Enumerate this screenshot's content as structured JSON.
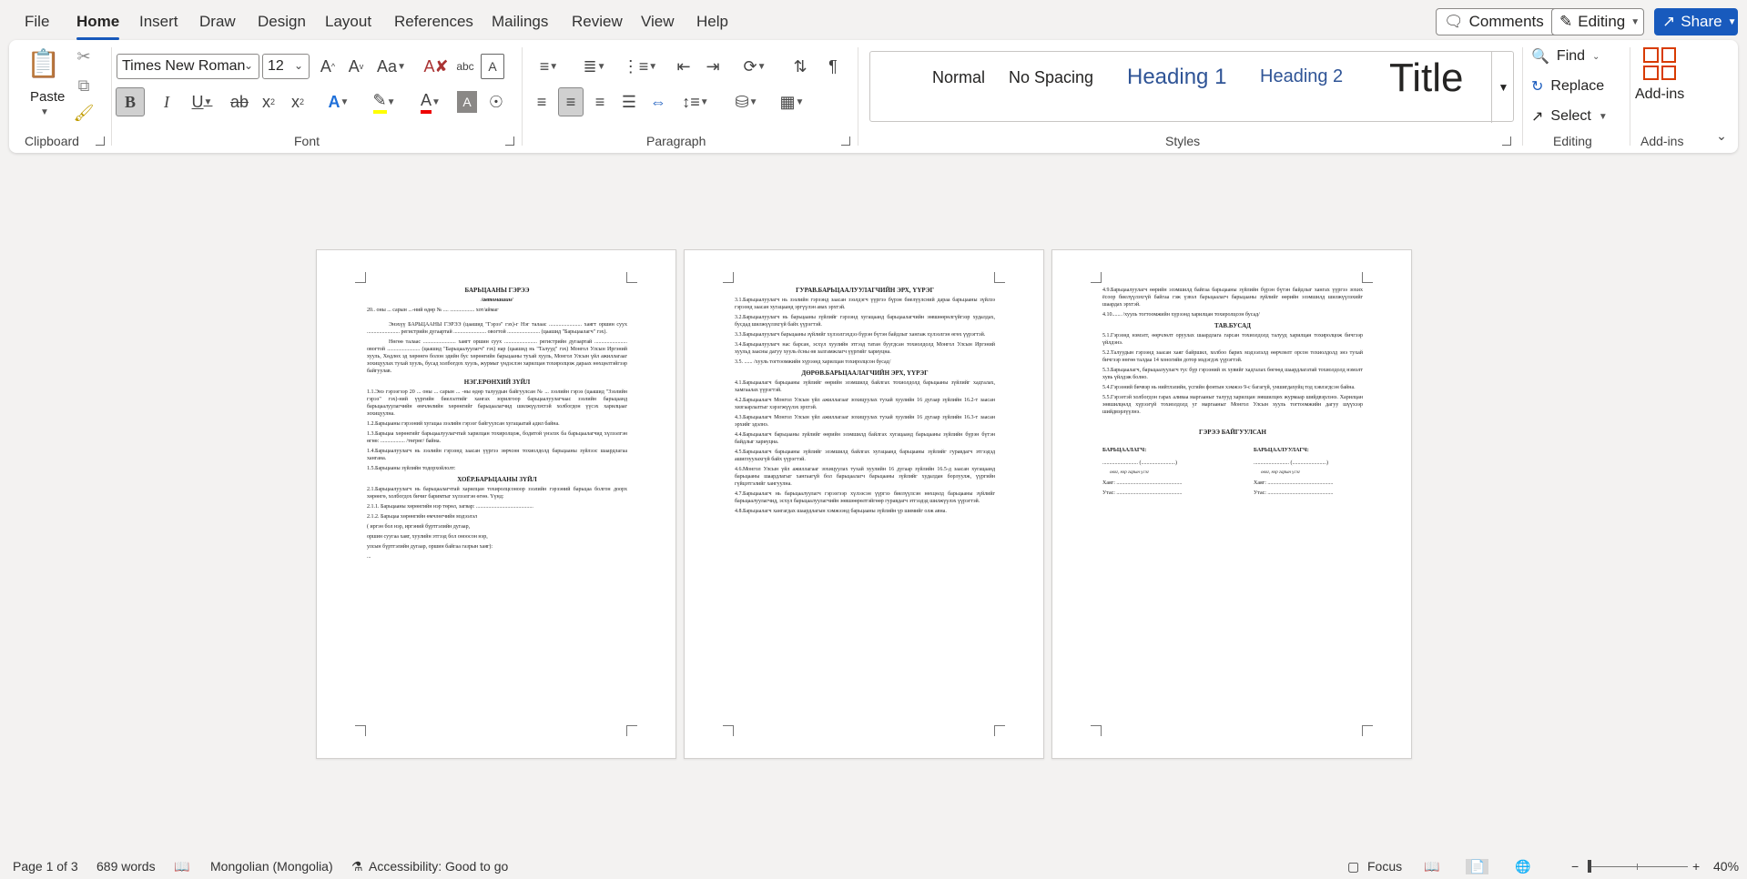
{
  "menu": {
    "tabs": [
      "File",
      "Home",
      "Insert",
      "Draw",
      "Design",
      "Layout",
      "References",
      "Mailings",
      "Review",
      "View",
      "Help"
    ],
    "active": "Home",
    "comments_label": "Comments",
    "editing_label": "Editing",
    "share_label": "Share"
  },
  "ribbon": {
    "clipboard": {
      "paste_label": "Paste",
      "group_label": "Clipboard"
    },
    "font": {
      "font_name": "Times New Roman",
      "font_size": "12",
      "group_label": "Font"
    },
    "paragraph": {
      "group_label": "Paragraph"
    },
    "styles": {
      "group_label": "Styles",
      "items": [
        "Normal",
        "No Spacing",
        "Heading 1",
        "Heading 2",
        "Title"
      ]
    },
    "editing": {
      "find_label": "Find",
      "replace_label": "Replace",
      "select_label": "Select",
      "group_label": "Editing"
    },
    "addins": {
      "label": "Add-ins",
      "group_label": "Add-ins"
    }
  },
  "pages": {
    "p1": {
      "title": "БАРЬЦААНЫ ГЭРЭЭ",
      "subtitle": "/автомашин/",
      "dateline": "20.. оны ... сарын ...-ний өдөр                    № ....                     .................. хот/аймаг",
      "para1": "Энэхүү БАРЬЦААНЫ ГЭРЭЭ (цаашид \"Гэрээ\" гэх)-г Нэг талаас ........................ хаягт оршин суух ........................ регистрийн дугаартай ........................ овогтой ........................ (цаашид \"Барьцаалагч\" гэх).",
      "para2": "Нөгөө талаас ........................ хаягт оршин суух ........................ регистрийн дугаартай ........................ овогтой ........................ (цаашид \"Барьцаалуулагч\" гэх) нар (цаашид нь \"Талууд\" гэх) Монгол Улсын Иргэний хууль, Хөдлөх эд хөрөнгө болон эдийн бус хөрөнгийн барьцааны тухай хууль, Монгол Улсын үйл ажиллагааг зохицуулах тухай хууль, бусад холбогдох хууль, журмыг үндэслэн харилцан тохиролцож дараах нөхцөлтэйгээр байгуулав.",
      "section1": "НЭГ.ЕРӨНХИЙ ЗҮЙЛ",
      "s1_1": "1.1.Энэ гэрээгээр 20 ... оны ... сарын ... -ны өдөр талуудын байгуулсан № ... зээлийн гэрээ (цаашид \"Зээлийн гэрээ\" гэх)-ний үүргийн биелэлтийг хангах зорилгоор барьцаалуулагчаас зээлийн барьцаанд барьцаалуулагчийн өмчлөлийн хөрөнгийг барьцаалагчид шилжүүлэхтэй холбогдон үүсэх харилцааг зохицуулна.",
      "s1_2": "1.2.Барьцааны гэрээний хугацаа зээлийн гэрээг байгуулсан хугацаатай адил байна.",
      "s1_3": "1.3.Барьцаа хөрөнгийг барьцаалуулагчтай харилцан тохиролцож, бодитой үнэлэх ба барьцаалагчид хүлээлгэн өгнө: .................. /төгрөг/ байна.",
      "s1_4": "1.4.Барьцаалуулагч нь зээлийн гэрээнд заасан үүргээ зөрчсөн тохиолдолд барьцааны зүйлээс шаардлагаа хангана.",
      "s1_5": "1.5.Барьцааны зүйлийн тодорхойлолт:",
      "section2": "ХОЁР.БАРЬЦААНЫ ЗҮЙЛ",
      "s2_1": "2.1.Барьцаалуулагч нь барьцаалагчтай харилцан тохиролцсоноор зээлийн гэрээний барьцаа болгон доорх хөрөнгө, холбогдох бичиг баримтыг хүлээлгэн өгнө. Үүнд:",
      "s2_1_1": "2.1.1. Барьцааны хөрөнгийн нэр төрөл, загвар: ..........................................",
      "s2_1_2": "2.1.2. Барьцаа хөрөнгийн өмчлөгчийн мэдээлэл",
      "s2_l1": "( иргэн бол нэр, иргэний бүртгэлийн дугаар,",
      "s2_l2": "оршин суугаа хаяг, хуулийн этгээд бол оноосон нэр,",
      "s2_l3": "улсын бүртгэлийн дугаар, оршин байгаа газрын хаяг):",
      "s2_l4": "..."
    },
    "p2": {
      "section3": "ГУРАВ.БАРЬЦААЛУУЛАГЧИЙН ЭРХ, ҮҮРЭГ",
      "s3_1": "3.1.Барьцаалуулагч нь зээлийн гэрээнд заасан зээлдэгч үүргээ бүрэн биелүүлсний дараа барьцааны зүйлээ гэрээнд заасан хугацаанд эргүүлэн авах эрхтэй.",
      "s3_2": "3.2.Барьцаалуулагч нь барьцааны зүйлийг гэрээнд хугацаанд барьцаалагчийн зөвшөөрөлгүйгээр худалдах, бусдад шилжүүлэхгүй байх үүрэгтэй.",
      "s3_3": "3.3.Барьцаалуулагч барьцааны зүйлийг хүлээлгэхдээ бүрэн бүтэн байдлыг хангаж хүлээлгэн өгөх үүрэгтэй.",
      "s3_4": "3.4.Барьцаалуулагч нас барсан, эсхүл хуулийн этгээд татан буугдсан тохиолдолд Монгол Улсын Иргэний хуульд заасны дагуу хууль ёсны өв залгамжлагч үүргийг хариуцна.",
      "s3_5": "3.5. ...... /хууль тогтоомжийн хүрээнд харилцан тохиролцсон бусад/",
      "section4": "ДӨРӨВ.БАРЬЦААЛАГЧИЙН ЭРХ, ҮҮРЭГ",
      "s4_1": "4.1.Барьцаалагч барьцааны зүйлийг өөрийн эзэмшилд байлгах тохиолдолд барьцааны зүйлийг хадгалах, хамгаалах үүрэгтэй.",
      "s4_2": "4.2.Барьцаалагч Монгол Улсын үйл ажиллагааг зохицуулах тухай хуулийн 16 дугаар зүйлийн 16.2-т заасан хязгаарлалтыг хэрэгжүүлэх эрхтэй.",
      "s4_3": "4.3.Барьцаалагч Монгол Улсын үйл ажиллагааг зохицуулах тухай хуулийн 16 дугаар зүйлийн 16.3-т заасан эрхийг эдэлнэ.",
      "s4_4": "4.4.Барьцаалагч барьцааны зүйлийг өөрийн эзэмшилд байлгах хугацаанд барьцааны зүйлийн бүрэн бүтэн байдлыг хариуцна.",
      "s4_5": "4.5.Барьцаалагч барьцааны зүйлийг эзэмшилд байлгах хугацаанд барьцааны зүйлийг гуравдагч этгээдэд ашиглуулахгүй байх үүрэгтэй.",
      "s4_6": "4.6.Монгол Улсын үйл ажиллагааг зохицуулах тухай хуулийн 16 дугаар зүйлийн 16.5-д заасан хугацаанд барьцааны шаардлагыг хангаагүй бол барьцаалагч барьцааны зүйлийг худалдан борлуулж, үүргийн гүйцэтгэлийг хангуулна.",
      "s4_7": "4.7.Барьцаалагч нь барьцаалуулагч гэрээгээр хүлээсэн үүргээ биелүүлсэн нөхцөлд барьцааны зүйлийг барьцаалуулагчид, эсхүл барьцаалуулагчийн зөвшөөрөлтэйгөөр гуравдагч этгээдэд шилжүүлэх үүрэгтэй.",
      "s4_8": "4.8.Барьцаалагч хангагдах шаардлагын хэмжээнд барьцааны зүйлийн үр шимийг олж авна."
    },
    "p3": {
      "s4_9": "4.9.Барьцаалуулагч өөрийн эзэмшилд байгаа барьцааны зүйлийн бүрэн бүтэн байдлыг хангах үүргээ зохих ёсоор биелүүлэхгүй байгаа гэж үзвэл барьцаалагч барьцааны зүйлийг өөрийн эзэмшилд шилжүүлэхийг шаардах эрхтэй.",
      "s4_10": "4.10....... /хууль тогтоомжийн хүрээнд харилцан тохиролцсон бусад/",
      "section5": "ТАВ.БУСАД",
      "s5_1": "5.1.Гэрээнд нэмэлт, өөрчлөлт оруулах шаардлага гарсан тохиолдолд талууд харилцан тохиролцож бичгээр үйлдэнэ.",
      "s5_2": "5.2.Талуудын гэрээнд заасан хаяг байршил, холбоо барих мэдээлэлд өөрчлөлт орсон тохиолдолд энэ тухай бичгээр нөгөө талдаа 14 хоногийн дотор мэдэгдэх үүрэгтэй.",
      "s5_3": "5.3.Барьцаалагч, барьцаалуулагч тус бүр гэрээний эх хувийг хадгалах бөгөөд шаардлагатай тохиолдолд нэмэлт хувь үйлдэж болно.",
      "s5_4": "5.4.Гэрээний бичвэр нь нийтлэлийн, үсгийн фонтын хэмжээ 9-с багагүй, уншигдахуйц тод хэвлэгдсэн байна.",
      "s5_5": "5.5.Гэрээтэй холбогдон гарах аливаа маргааныг талууд харилцан зөвшилцөх журмаар шийдвэрлэнэ. Харилцан зөвшилцөлд хүрээгүй тохиолдолд уг маргааныг Монгол Улсын хууль тогтоомжийн дагуу шүүхээр шийдвэрлүүлнэ.",
      "sign_title": "ГЭРЭЭ БАЙГУУЛСАН",
      "lender_label": "БАРЬЦААЛАГЧ:",
      "borrower_label": "БАРЬЦААЛУУЛАГЧ:",
      "sig_line": ".......................... (.........................)",
      "sig_caption": "овог, нэр        гарын үсэг",
      "addr": "Хаяг: ................................................",
      "phone": "Утас: ................................................"
    }
  },
  "status": {
    "page": "Page 1 of 3",
    "words": "689 words",
    "language": "Mongolian (Mongolia)",
    "accessibility": "Accessibility: Good to go",
    "focus": "Focus",
    "zoom": "40%"
  }
}
